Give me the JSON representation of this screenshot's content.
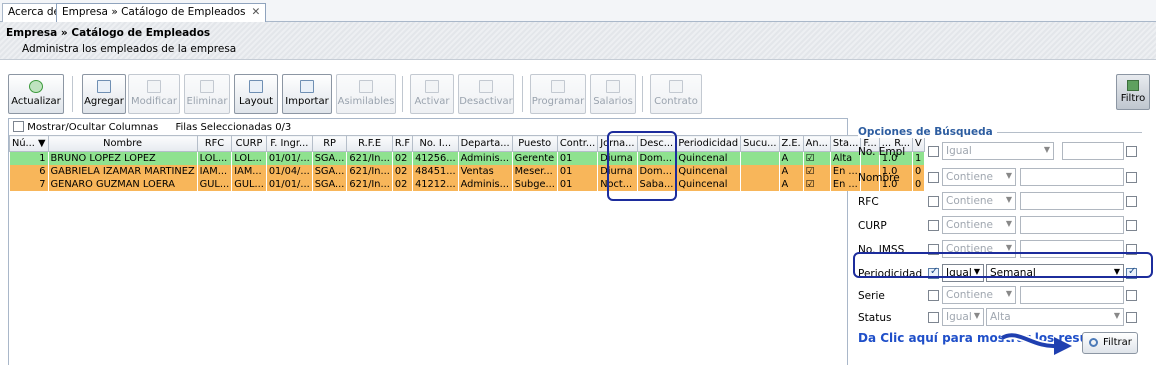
{
  "tabs": [
    {
      "label": "Acerca de"
    },
    {
      "label": "Empresa » Catálogo de Empleados"
    }
  ],
  "header": {
    "title": "Empresa » Catálogo de Empleados",
    "subtitle": "Administra los empleados de la empresa"
  },
  "toolbar": {
    "actualizar": "Actualizar",
    "agregar": "Agregar",
    "modificar": "Modificar",
    "eliminar": "Eliminar",
    "layout": "Layout",
    "importar": "Importar",
    "asimilables": "Asimilables",
    "activar": "Activar",
    "desactivar": "Desactivar",
    "programar": "Programar",
    "salarios": "Salarios",
    "contrato": "Contrato",
    "filtro": "Filtro"
  },
  "grid": {
    "toggle_columns": "Mostrar/Ocultar Columnas",
    "selected": "Filas Seleccionadas 0/3",
    "headers": [
      "Nú... ▼",
      "Nombre",
      "RFC",
      "CURP",
      "F. Ingr...",
      "RP",
      "R.F.E",
      "R.F",
      "No. I...",
      "Departa...",
      "Puesto",
      "Contr...",
      "Jorna...",
      "Desc...",
      "Periodicidad",
      "Sucu...",
      "Z.E.",
      "An...",
      "Sta...",
      "F...",
      "... R...",
      "V"
    ],
    "rows": [
      {
        "cls": "green",
        "cells": [
          "1",
          "BRUNO LOPEZ LOPEZ",
          "LOL...",
          "LOL...",
          "01/01/...",
          "SGA...",
          "621/In...",
          "02",
          "41256...",
          "Adminis...",
          "Gerente",
          "01",
          "Diurna",
          "Dom...",
          "Quincenal",
          "",
          "A",
          "☑",
          "Alta",
          "",
          "1.0",
          "1"
        ]
      },
      {
        "cls": "orange",
        "cells": [
          "6",
          "GABRIELA IZAMAR MARTINEZ",
          "IAM...",
          "IAM...",
          "01/04/...",
          "SGA...",
          "621/In...",
          "02",
          "48451...",
          "Ventas",
          "Meser...",
          "01",
          "Diurna",
          "Dom...",
          "Quincenal",
          "",
          "A",
          "☑",
          "En ...",
          "",
          "1.0",
          "0"
        ]
      },
      {
        "cls": "orange",
        "cells": [
          "7",
          "GENARO GUZMAN LOERA",
          "GUL...",
          "GUL...",
          "01/01/...",
          "SGA...",
          "621/In...",
          "02",
          "41212...",
          "Adminis...",
          "Subge...",
          "01",
          "Noct...",
          "Saba...",
          "Quincenal",
          "",
          "A",
          "☑",
          "En ...",
          "",
          "1.0",
          "0"
        ]
      }
    ]
  },
  "search": {
    "legend": "Opciones de Búsqueda",
    "rows": [
      {
        "label": "No. Empl",
        "op": "Igual",
        "value": ""
      },
      {
        "label": "Nombre",
        "op": "Contiene",
        "value": ""
      },
      {
        "label": "RFC",
        "op": "Contiene",
        "value": ""
      },
      {
        "label": "CURP",
        "op": "Contiene",
        "value": ""
      },
      {
        "label": "No. IMSS",
        "op": "Contiene",
        "value": ""
      },
      {
        "label": "Periodicidad",
        "op": "Igual",
        "value": "Semanal"
      },
      {
        "label": "Serie",
        "op": "Contiene",
        "value": ""
      },
      {
        "label": "Status",
        "op": "Igual",
        "value": "Alta"
      }
    ],
    "hint": "Da Clic aquí para mostrar los resultados",
    "filter_button": "Filtrar"
  }
}
